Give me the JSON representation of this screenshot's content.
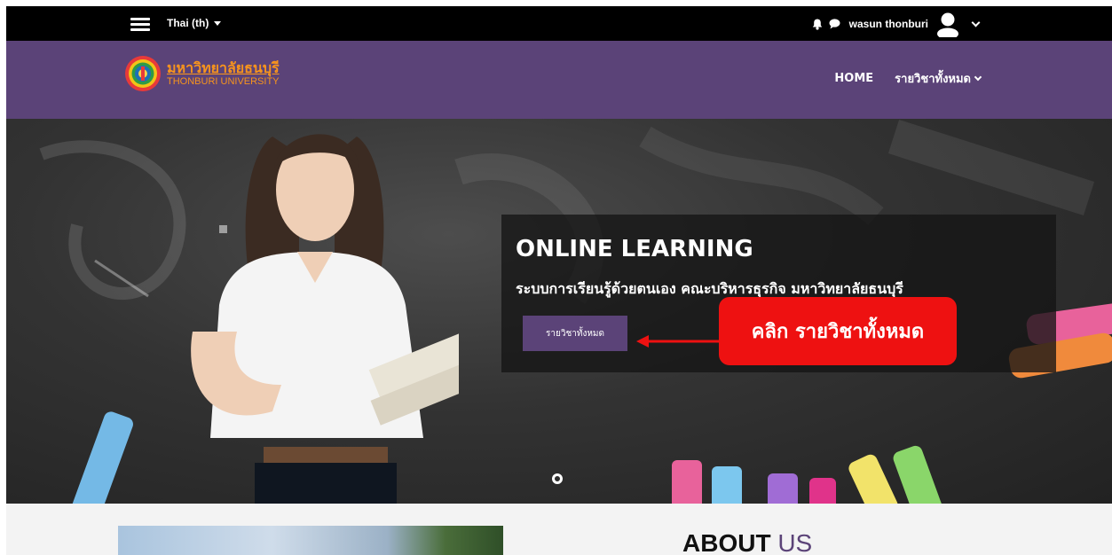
{
  "topbar": {
    "language": "Thai (th)",
    "user_name": "wasun thonburi"
  },
  "navbar": {
    "logo_th": "มหาวิทยาลัยธนบุรี",
    "logo_en": "THONBURI UNIVERSITY",
    "links": [
      {
        "label": "HOME"
      },
      {
        "label": "รายวิชาทั้งหมด"
      }
    ]
  },
  "hero": {
    "title": "ONLINE LEARNING",
    "subtitle": "ระบบการเรียนรู้ด้วยตนเอง คณะบริหารธุรกิจ มหาวิทยาลัยธนบุรี",
    "button_label": "รายวิชาทั้งหมด",
    "callout": "คลิก รายวิชาทั้งหมด"
  },
  "about": {
    "title_bold": "ABOUT",
    "title_light": "US"
  },
  "colors": {
    "brand_purple": "#5b4378",
    "logo_orange": "#f7941d",
    "callout_red": "#ee1111"
  }
}
